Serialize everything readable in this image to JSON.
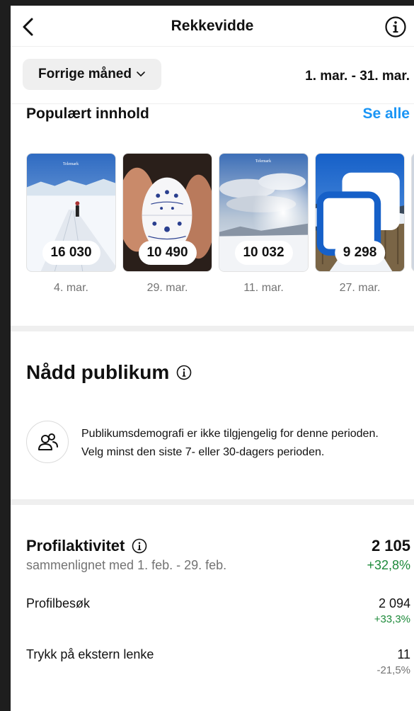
{
  "header": {
    "title": "Rekkevidde",
    "back_icon": "chevron-left-icon",
    "info_icon": "info-icon"
  },
  "filter": {
    "period_label": "Forrige måned",
    "period_icon": "chevron-down-icon",
    "date_range": "1. mar. - 31. mar."
  },
  "popular": {
    "title": "Populært innhold",
    "see_all": "Se alle",
    "items": [
      {
        "count": "16 030",
        "date": "4. mar.",
        "photo_caption": "Telemark"
      },
      {
        "count": "10 490",
        "date": "29. mar."
      },
      {
        "count": "10 032",
        "date": "11. mar.",
        "photo_caption": "Telemark"
      },
      {
        "count": "9 298",
        "date": "27. mar.",
        "multi_icon": "carousel-icon"
      }
    ]
  },
  "audience": {
    "title": "Nådd publikum",
    "info_icon": "info-icon",
    "icon": "people-icon",
    "message_line1": "Publikumsdemografi er ikke tilgjengelig for denne perioden.",
    "message_line2": "Velg minst den siste 7- eller 30-dagers perioden."
  },
  "profile_activity": {
    "title": "Profilaktivitet",
    "info_icon": "info-icon",
    "comparison": "sammenlignet med 1. feb. - 29. feb.",
    "total": "2 105",
    "total_change": "+32,8%",
    "rows": [
      {
        "label": "Profilbesøk",
        "value": "2 094",
        "change": "+33,3%"
      },
      {
        "label": "Trykk på ekstern lenke",
        "value": "11",
        "change": "-21,5%"
      }
    ]
  },
  "colors": {
    "accent": "#1a95f5",
    "positive": "#1d8a3a",
    "muted": "#737373",
    "band": "#efefef"
  }
}
